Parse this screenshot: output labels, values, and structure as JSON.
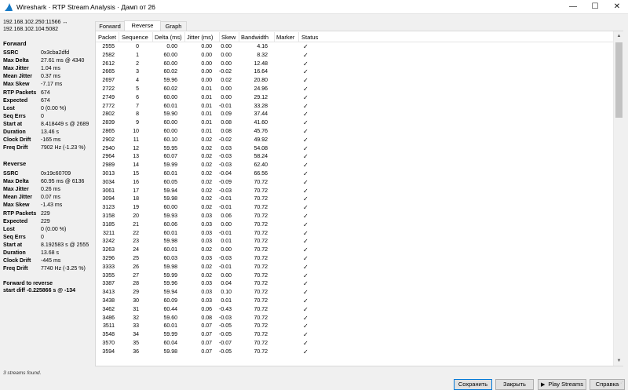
{
  "window": {
    "title": "Wireshark · RTP Stream Analysis · Дамп от 26",
    "minimize": "—",
    "maximize": "☐",
    "close": "✕"
  },
  "left_panel": {
    "streams_line1": "192.168.102.250:11566 ↔",
    "streams_line2": "192.168.102.104:5082",
    "forward": {
      "heading": "Forward",
      "items": [
        {
          "k": "SSRC",
          "v": "0x3cba2dfd"
        },
        {
          "k": "Max Delta",
          "v": "27.61 ms @ 4340"
        },
        {
          "k": "Max Jitter",
          "v": "1.04 ms"
        },
        {
          "k": "Mean Jitter",
          "v": "0.37 ms"
        },
        {
          "k": "Max Skew",
          "v": "-7.17 ms"
        },
        {
          "k": "RTP Packets",
          "v": "674"
        },
        {
          "k": "Expected",
          "v": "674"
        },
        {
          "k": "Lost",
          "v": "0 (0.00 %)"
        },
        {
          "k": "Seq Errs",
          "v": "0"
        },
        {
          "k": "Start at",
          "v": "8.418449 s @ 2689"
        },
        {
          "k": "Duration",
          "v": "13.46 s"
        },
        {
          "k": "Clock Drift",
          "v": "-165 ms"
        },
        {
          "k": "Freq Drift",
          "v": "7902 Hz (-1.23 %)"
        }
      ]
    },
    "reverse": {
      "heading": "Reverse",
      "items": [
        {
          "k": "SSRC",
          "v": "0x19c60709"
        },
        {
          "k": "Max Delta",
          "v": "60.95 ms @ 6136"
        },
        {
          "k": "Max Jitter",
          "v": "0.26 ms"
        },
        {
          "k": "Mean Jitter",
          "v": "0.07 ms"
        },
        {
          "k": "Max Skew",
          "v": "-1.43 ms"
        },
        {
          "k": "RTP Packets",
          "v": "229"
        },
        {
          "k": "Expected",
          "v": "229"
        },
        {
          "k": "Lost",
          "v": "0 (0.00 %)"
        },
        {
          "k": "Seq Errs",
          "v": "0"
        },
        {
          "k": "Start at",
          "v": "8.192583 s @ 2555"
        },
        {
          "k": "Duration",
          "v": "13.68 s"
        },
        {
          "k": "Clock Drift",
          "v": "-445 ms"
        },
        {
          "k": "Freq Drift",
          "v": "7740 Hz (-3.25 %)"
        }
      ]
    },
    "f2r_line1": "Forward to reverse",
    "f2r_line2": "start diff -0.225866 s @ -134"
  },
  "tabs": [
    "Forward",
    "Reverse",
    "Graph"
  ],
  "active_tab": "Reverse",
  "columns": [
    "Packet",
    "Sequence",
    "Delta (ms)",
    "Jitter (ms)",
    "Skew",
    "Bandwidth",
    "Marker",
    "Status"
  ],
  "check_glyph": "✓",
  "rows": [
    [
      "2555",
      "0",
      "0.00",
      "0.00",
      "0.00",
      "4.16"
    ],
    [
      "2582",
      "1",
      "60.00",
      "0.00",
      "0.00",
      "8.32"
    ],
    [
      "2612",
      "2",
      "60.00",
      "0.00",
      "0.00",
      "12.48"
    ],
    [
      "2665",
      "3",
      "60.02",
      "0.00",
      "-0.02",
      "16.64"
    ],
    [
      "2697",
      "4",
      "59.96",
      "0.00",
      "0.02",
      "20.80"
    ],
    [
      "2722",
      "5",
      "60.02",
      "0.01",
      "0.00",
      "24.96"
    ],
    [
      "2749",
      "6",
      "60.00",
      "0.01",
      "0.00",
      "29.12"
    ],
    [
      "2772",
      "7",
      "60.01",
      "0.01",
      "-0.01",
      "33.28"
    ],
    [
      "2802",
      "8",
      "59.90",
      "0.01",
      "0.09",
      "37.44"
    ],
    [
      "2839",
      "9",
      "60.00",
      "0.01",
      "0.08",
      "41.60"
    ],
    [
      "2865",
      "10",
      "60.00",
      "0.01",
      "0.08",
      "45.76"
    ],
    [
      "2902",
      "11",
      "60.10",
      "0.02",
      "-0.02",
      "49.92"
    ],
    [
      "2940",
      "12",
      "59.95",
      "0.02",
      "0.03",
      "54.08"
    ],
    [
      "2964",
      "13",
      "60.07",
      "0.02",
      "-0.03",
      "58.24"
    ],
    [
      "2989",
      "14",
      "59.99",
      "0.02",
      "-0.03",
      "62.40"
    ],
    [
      "3013",
      "15",
      "60.01",
      "0.02",
      "-0.04",
      "66.56"
    ],
    [
      "3034",
      "16",
      "60.05",
      "0.02",
      "-0.09",
      "70.72"
    ],
    [
      "3061",
      "17",
      "59.94",
      "0.02",
      "-0.03",
      "70.72"
    ],
    [
      "3094",
      "18",
      "59.98",
      "0.02",
      "-0.01",
      "70.72"
    ],
    [
      "3123",
      "19",
      "60.00",
      "0.02",
      "-0.01",
      "70.72"
    ],
    [
      "3158",
      "20",
      "59.93",
      "0.03",
      "0.06",
      "70.72"
    ],
    [
      "3185",
      "21",
      "60.06",
      "0.03",
      "0.00",
      "70.72"
    ],
    [
      "3211",
      "22",
      "60.01",
      "0.03",
      "-0.01",
      "70.72"
    ],
    [
      "3242",
      "23",
      "59.98",
      "0.03",
      "0.01",
      "70.72"
    ],
    [
      "3263",
      "24",
      "60.01",
      "0.02",
      "0.00",
      "70.72"
    ],
    [
      "3296",
      "25",
      "60.03",
      "0.03",
      "-0.03",
      "70.72"
    ],
    [
      "3333",
      "26",
      "59.98",
      "0.02",
      "-0.01",
      "70.72"
    ],
    [
      "3355",
      "27",
      "59.99",
      "0.02",
      "0.00",
      "70.72"
    ],
    [
      "3387",
      "28",
      "59.96",
      "0.03",
      "0.04",
      "70.72"
    ],
    [
      "3413",
      "29",
      "59.94",
      "0.03",
      "0.10",
      "70.72"
    ],
    [
      "3438",
      "30",
      "60.09",
      "0.03",
      "0.01",
      "70.72"
    ],
    [
      "3462",
      "31",
      "60.44",
      "0.06",
      "-0.43",
      "70.72"
    ],
    [
      "3486",
      "32",
      "59.60",
      "0.08",
      "-0.03",
      "70.72"
    ],
    [
      "3511",
      "33",
      "60.01",
      "0.07",
      "-0.05",
      "70.72"
    ],
    [
      "3548",
      "34",
      "59.99",
      "0.07",
      "-0.05",
      "70.72"
    ],
    [
      "3570",
      "35",
      "60.04",
      "0.07",
      "-0.07",
      "70.72"
    ],
    [
      "3594",
      "36",
      "59.98",
      "0.07",
      "-0.05",
      "70.72"
    ]
  ],
  "status_bar": "3 streams found.",
  "buttons": {
    "save": "Сохранить",
    "close": "Закрыть",
    "play": "Play Streams",
    "help": "Справка"
  }
}
